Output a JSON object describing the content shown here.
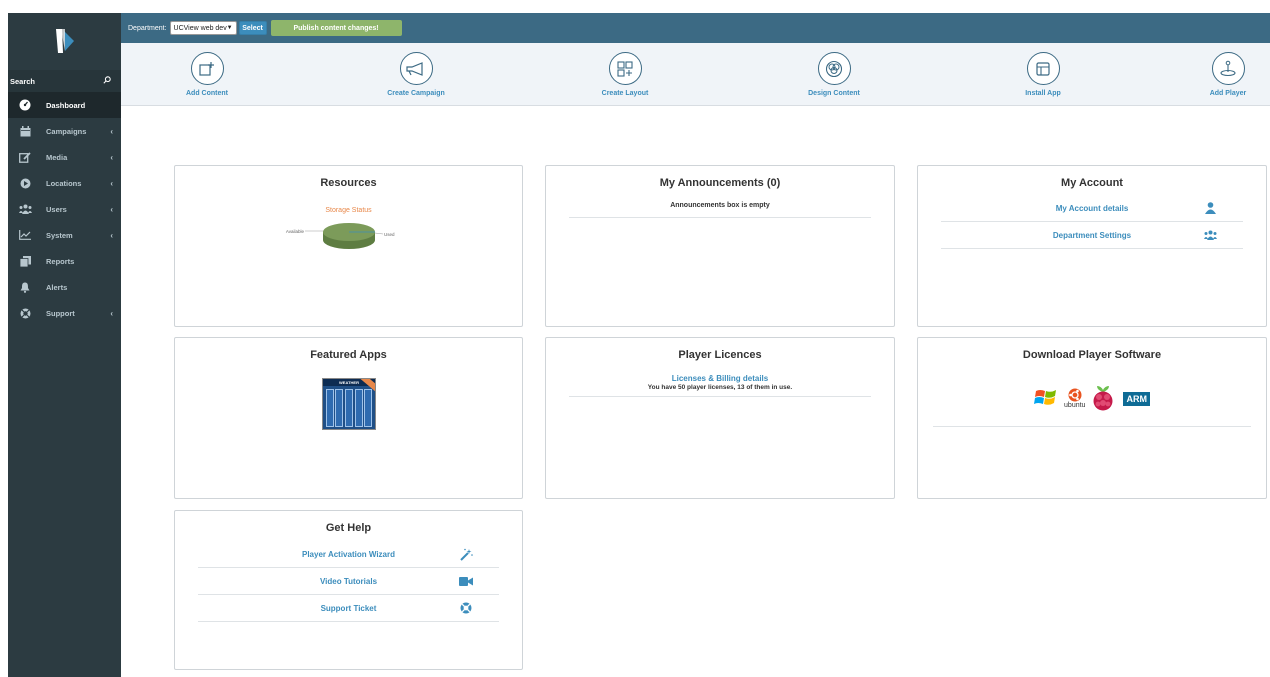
{
  "sidebar": {
    "search_label": "Search",
    "items": [
      {
        "label": "Dashboard",
        "icon": "dashboard-icon",
        "active": true,
        "chevron": false
      },
      {
        "label": "Campaigns",
        "icon": "calendar-icon",
        "chevron": true
      },
      {
        "label": "Media",
        "icon": "edit-icon",
        "chevron": true
      },
      {
        "label": "Locations",
        "icon": "location-icon",
        "chevron": true
      },
      {
        "label": "Users",
        "icon": "users-icon",
        "chevron": true
      },
      {
        "label": "System",
        "icon": "chart-icon",
        "chevron": true
      },
      {
        "label": "Reports",
        "icon": "reports-icon",
        "chevron": false
      },
      {
        "label": "Alerts",
        "icon": "bell-icon",
        "chevron": false
      },
      {
        "label": "Support",
        "icon": "lifebuoy-icon",
        "chevron": true
      }
    ],
    "chevron_glyph": "‹"
  },
  "topbar": {
    "department_label": "Department:",
    "department_value": "UCView web dev",
    "select_label": "Select",
    "publish_label": "Publish content changes!"
  },
  "quick_actions": [
    {
      "label": "Add Content",
      "icon": "add-content-icon"
    },
    {
      "label": "Create Campaign",
      "icon": "megaphone-icon"
    },
    {
      "label": "Create Layout",
      "icon": "layout-grid-icon"
    },
    {
      "label": "Design Content",
      "icon": "design-icon"
    },
    {
      "label": "Install App",
      "icon": "app-window-icon"
    },
    {
      "label": "Add Player",
      "icon": "player-icon"
    }
  ],
  "panels": {
    "resources": {
      "title": "Resources",
      "chart_title": "Storage Status",
      "legend_available": "Available",
      "legend_used": "Used"
    },
    "announcements": {
      "title": "My Announcements (0)",
      "empty_text": "Announcements box is empty"
    },
    "account": {
      "title": "My Account",
      "links": [
        "My Account details",
        "Department Settings"
      ]
    },
    "featured": {
      "title": "Featured Apps",
      "app_label": "WEATHER"
    },
    "licences": {
      "title": "Player Licences",
      "link": "Licenses & Billing details",
      "text": "You have 50 player licenses, 13 of them in use."
    },
    "download": {
      "title": "Download Player Software",
      "ubuntu_label": "ubuntu",
      "arm_label": "ARM"
    },
    "help": {
      "title": "Get Help",
      "links": [
        "Player Activation Wizard",
        "Video Tutorials",
        "Support Ticket"
      ]
    }
  },
  "colors": {
    "sidebar_bg": "#2c3b41",
    "topbar_bg": "#3c6a84",
    "link": "#3c8dbc",
    "publish": "#8eb56b",
    "pie_available": "#7c9b5a",
    "storage_title": "#e8884a"
  }
}
